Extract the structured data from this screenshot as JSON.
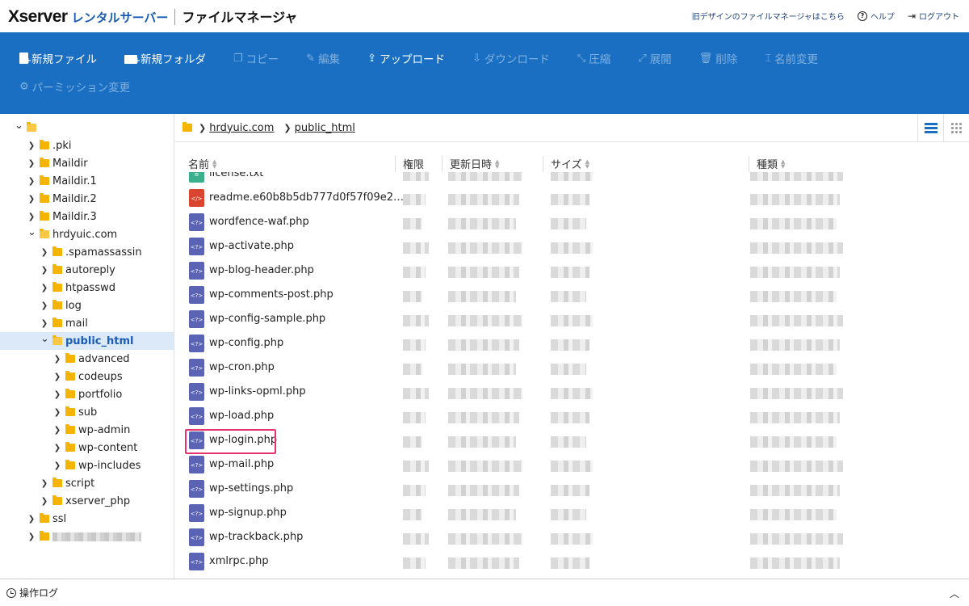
{
  "header": {
    "brand": "Xserver",
    "brand_sub": "レンタルサーバー",
    "app_title": "ファイルマネージャ",
    "links": {
      "old_design": "旧デザインのファイルマネージャはこちら",
      "help": "ヘルプ",
      "logout": "ログアウト"
    }
  },
  "toolbar": {
    "new_file": "新規ファイル",
    "new_folder": "新規フォルダ",
    "copy": "コピー",
    "edit": "編集",
    "upload": "アップロード",
    "download": "ダウンロード",
    "compress": "圧縮",
    "extract": "展開",
    "delete": "削除",
    "rename": "名前変更",
    "permission": "パーミッション変更"
  },
  "sidebar": {
    "items": [
      {
        "label": "",
        "depth": 0,
        "expanded": true
      },
      {
        "label": ".pki",
        "depth": 1,
        "expanded": false
      },
      {
        "label": "Maildir",
        "depth": 1,
        "expanded": false
      },
      {
        "label": "Maildir.1",
        "depth": 1,
        "expanded": false
      },
      {
        "label": "Maildir.2",
        "depth": 1,
        "expanded": false
      },
      {
        "label": "Maildir.3",
        "depth": 1,
        "expanded": false
      },
      {
        "label": "hrdyuic.com",
        "depth": 1,
        "expanded": true
      },
      {
        "label": ".spamassassin",
        "depth": 2,
        "expanded": false
      },
      {
        "label": "autoreply",
        "depth": 2,
        "expanded": false
      },
      {
        "label": "htpasswd",
        "depth": 2,
        "expanded": false
      },
      {
        "label": "log",
        "depth": 2,
        "expanded": false
      },
      {
        "label": "mail",
        "depth": 2,
        "expanded": false
      },
      {
        "label": "public_html",
        "depth": 2,
        "expanded": true,
        "selected": true
      },
      {
        "label": "advanced",
        "depth": 3,
        "expanded": false
      },
      {
        "label": "codeups",
        "depth": 3,
        "expanded": false
      },
      {
        "label": "portfolio",
        "depth": 3,
        "expanded": false
      },
      {
        "label": "sub",
        "depth": 3,
        "expanded": false
      },
      {
        "label": "wp-admin",
        "depth": 3,
        "expanded": false
      },
      {
        "label": "wp-content",
        "depth": 3,
        "expanded": false
      },
      {
        "label": "wp-includes",
        "depth": 3,
        "expanded": false
      },
      {
        "label": "script",
        "depth": 2,
        "expanded": false
      },
      {
        "label": "xserver_php",
        "depth": 2,
        "expanded": false
      },
      {
        "label": "ssl",
        "depth": 1,
        "expanded": false
      },
      {
        "label": "",
        "depth": 1,
        "expanded": false,
        "blurred": true
      }
    ]
  },
  "breadcrumb": {
    "items": [
      "hrdyuic.com",
      "public_html"
    ]
  },
  "columns": {
    "name": "名前",
    "permission": "権限",
    "modified": "更新日時",
    "size": "サイズ",
    "type": "種類"
  },
  "files": [
    {
      "name": "license.txt",
      "kind": "txt"
    },
    {
      "name": "readme.e60b8b5db777d0f57f09e2…",
      "kind": "html"
    },
    {
      "name": "wordfence-waf.php",
      "kind": "php"
    },
    {
      "name": "wp-activate.php",
      "kind": "php"
    },
    {
      "name": "wp-blog-header.php",
      "kind": "php"
    },
    {
      "name": "wp-comments-post.php",
      "kind": "php"
    },
    {
      "name": "wp-config-sample.php",
      "kind": "php"
    },
    {
      "name": "wp-config.php",
      "kind": "php"
    },
    {
      "name": "wp-cron.php",
      "kind": "php"
    },
    {
      "name": "wp-links-opml.php",
      "kind": "php"
    },
    {
      "name": "wp-load.php",
      "kind": "php"
    },
    {
      "name": "wp-login.php",
      "kind": "php",
      "highlighted": true
    },
    {
      "name": "wp-mail.php",
      "kind": "php"
    },
    {
      "name": "wp-settings.php",
      "kind": "php"
    },
    {
      "name": "wp-signup.php",
      "kind": "php"
    },
    {
      "name": "wp-trackback.php",
      "kind": "php"
    },
    {
      "name": "xmlrpc.php",
      "kind": "php"
    }
  ],
  "file_icons": {
    "php": "<?>",
    "html": "</>",
    "txt": "≡"
  },
  "footer": {
    "log_label": "操作ログ"
  },
  "colors": {
    "toolbar_bg": "#1a6fc3",
    "brand_blue": "#1a5cb5",
    "folder": "#f4b400",
    "php_icon": "#5b63b4",
    "highlight": "#e6336e"
  }
}
